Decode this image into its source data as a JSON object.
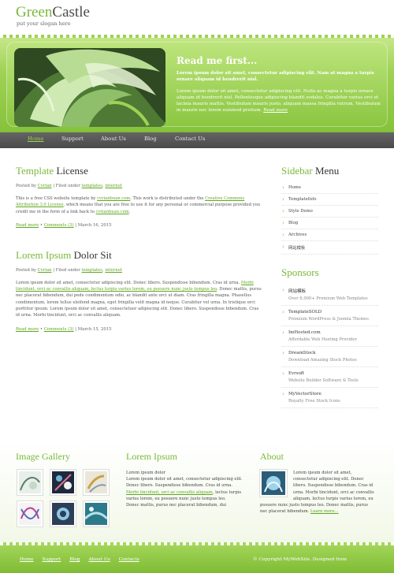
{
  "header": {
    "logo_part1": "Green",
    "logo_part2": "Castle",
    "slogan": "put your slogan here"
  },
  "banner": {
    "title": "Read me first...",
    "lead": "Lorem ipsum dolor sit amet, consectetur adipiscing elit. Nam at magna a turpis ornare aliquam id hendrerit nisl.",
    "body": "Lorem ipsum dolor sit amet, consectetur adipiscing elit. Nulla ac magna a turpis ornare aliquam id hendrerit nisl. Pellentesque adipiscing blandit sodales. Curabitur varius orci et lacinia mauris mattis. Vestibulum mauris justo, aliquam massa fringilla rutrum. Vestibulum in mauris nec lorem euismod pretium.",
    "read_more": "Read more"
  },
  "nav": {
    "items": [
      "Home",
      "Support",
      "About Us",
      "Blog",
      "Contact Us"
    ]
  },
  "posts": [
    {
      "title_hl": "Template",
      "title_rest": " License",
      "meta_prefix": "Posted by ",
      "author": "Cvrian",
      "meta_mid": " | Filed under ",
      "cat1": "templates",
      "meta_sep": ", ",
      "cat2": "internet",
      "body_1": "This is a free CSS website template by ",
      "body_link1": "cvrianbuan.com",
      "body_2": ". This work is distributed under the ",
      "body_link2": "Creative Commons Attribution 3.0 License",
      "body_3": ", which means that you are free to use it for any personal or commercial purpose provided you credit me in the form of a link back to ",
      "body_link3": "cvrianbuan.com",
      "body_4": ".",
      "read_more": "Read more",
      "bullet": " • ",
      "comments": "Comments (3)",
      "date": " | March 16, 2015"
    },
    {
      "title_hl": "Lorem Ipsum",
      "title_rest": " Dolor Sit",
      "meta_prefix": "Posted by ",
      "author": "Cvrian",
      "meta_mid": " | Filed under ",
      "cat1": "templates",
      "meta_sep": ", ",
      "cat2": "internet",
      "body_1": "Lorem ipsum dolor sit amet, consectetur adipiscing elit. Donec libero. Suspendisse bibendum. Cras id urna. ",
      "body_link1": "Morbi tincidunt, orci ac convallis aliquam, lectus turpis varius lorem, eu posuere nunc justo tempus leo",
      "body_2": ". Donec mattis, purus nec placerat bibendum, dui pede condimentum odio, ac blandit ante orci ut diam. Cras fringilla magna. Phasellus condimentum, lorem tellus eleifend magna, eget fringilla velit magna id neque. Curabitur vel urna. In tristique orci porttitor ipsum. Lorem ipsum dolor sit amet, consectetuer adipiscing elit. Donec libero. Suspendisse bibendum. Cras id urna. Morbi tincidunt, orci ac convallis aliquam.",
      "read_more": "Read more",
      "bullet": " • ",
      "comments": "Comments (3)",
      "date": " | March 15, 2015"
    }
  ],
  "sidebar": {
    "menu_title_hl": "Sidebar",
    "menu_title_rest": " Menu",
    "menu_items": [
      "Home",
      "TemplateInfo",
      "Style Demo",
      "Blog",
      "Archives",
      "网站模板"
    ],
    "sponsors_title": "Sponsors",
    "sponsors": [
      {
        "name": "网站模板",
        "desc": "Over 6,000+ Premium Web Templates"
      },
      {
        "name": "TemplateSOLD",
        "desc": "Premium WordPress & Joomla Themes"
      },
      {
        "name": "ImHosted.com",
        "desc": "Affordable Web Hosting Provider"
      },
      {
        "name": "DreamStock",
        "desc": "Download Amazing Stock Photos"
      },
      {
        "name": "Evrsoft",
        "desc": "Website Builder Software & Tools"
      },
      {
        "name": "MyVectorStore",
        "desc": "Royalty Free Stock Icons"
      }
    ]
  },
  "bottom": {
    "gallery_title": "Image Gallery",
    "lorem_title": "Lorem Ipsum",
    "lorem_line1": "Lorem ipsum dolor",
    "lorem_line2": "Lorem ipsum dolor sit amet, consectetur adipiscing elit. Donec libero. Suspendisse bibendum. Cras id urna. ",
    "lorem_link": "Morbi tincidunt, orci ac convallis aliquam",
    "lorem_line3": ", lectus turpis varius lorem, eu posuere nunc justo tempus leo.",
    "lorem_line4": "Donec mattis, purus nec placerat bibendum, dui",
    "about_title": "About",
    "about_text": "Lorem ipsum dolor sit amet, consectetur adipiscing elit. Donec libero. Suspendisse bibendum. Cras id urna. Morbi tincidunt, orci ac convallis aliquam, lectus turpis varius lorem, eu posuere nunc justo tempus leo. Donec mattis, purus nec placerat bibendum. ",
    "about_link": "Learn more..."
  },
  "footer": {
    "links": [
      "Home",
      "Support",
      "Blog",
      "About Us",
      "Contacts"
    ],
    "copyright": "© Copyright MyWebSite. Designed from"
  }
}
